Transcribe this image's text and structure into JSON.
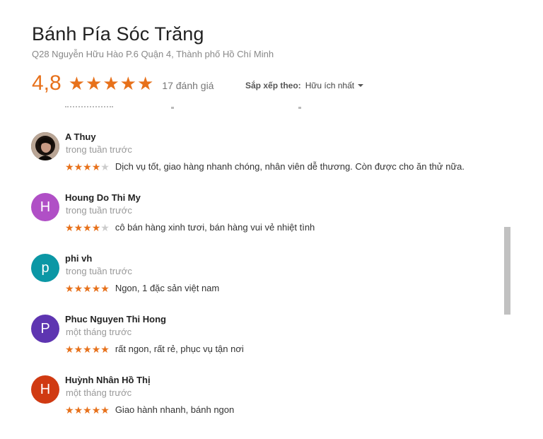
{
  "place": {
    "title": "Bánh Pía Sóc Trăng",
    "address": "Q28 Nguyễn Hữu Hào P.6 Quận 4, Thành phố Hồ Chí Minh",
    "rating": "4,8",
    "rating_value": 4.8,
    "review_count": "17 đánh giá"
  },
  "sort": {
    "label": "Sắp xếp theo:",
    "value": "Hữu ích nhất"
  },
  "colors": {
    "star": "#e7711b",
    "star_empty": "#cccccc"
  },
  "reviews": [
    {
      "name": "A Thuy",
      "time": "trong tuần trước",
      "stars": 4,
      "text": "Dịch vụ tốt, giao hàng nhanh chóng, nhân viên dễ thương. Còn được cho ăn thử nữa.",
      "avatar_letter": "",
      "avatar_color": "#3a2a22"
    },
    {
      "name": "Houng Do Thi My",
      "time": "trong tuần trước",
      "stars": 4,
      "text": "cô bán hàng xinh tươi, bán hàng vui vẻ nhiệt tình",
      "avatar_letter": "H",
      "avatar_color": "#b04fc6"
    },
    {
      "name": "phi vh",
      "time": "trong tuần trước",
      "stars": 5,
      "text": "Ngon, 1 đặc sản việt nam",
      "avatar_letter": "p",
      "avatar_color": "#0b97a5"
    },
    {
      "name": "Phuc Nguyen Thi Hong",
      "time": "một tháng trước",
      "stars": 5,
      "text": "rất ngon, rất rẻ, phục vụ tận nơi",
      "avatar_letter": "P",
      "avatar_color": "#5e35b1"
    },
    {
      "name": "Huỳnh Nhân Hồ Thị",
      "time": "một tháng trước",
      "stars": 5,
      "text": "Giao hành nhanh, bánh ngon",
      "avatar_letter": "H",
      "avatar_color": "#d03a12"
    }
  ]
}
